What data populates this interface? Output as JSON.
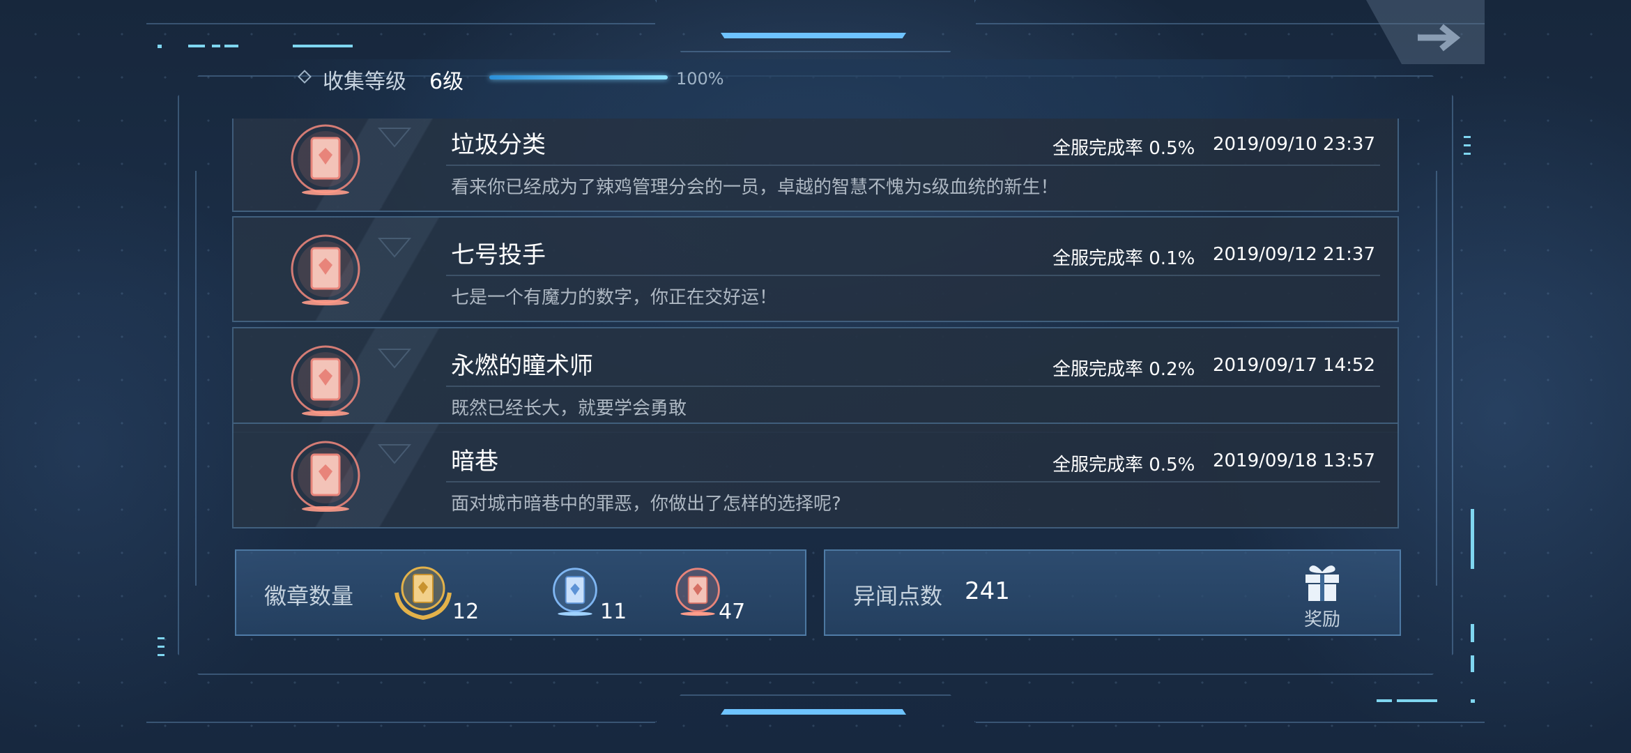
{
  "header": {
    "level_label": "收集等级",
    "level_value": "6级",
    "progress_percent": 100,
    "progress_text": "100%"
  },
  "achievements": [
    {
      "title": "垃圾分类",
      "rate": "全服完成率 0.5%",
      "date": "2019/09/10 23:37",
      "description": "看来你已经成为了辣鸡管理分会的一员，卓越的智慧不愧为s级血统的新生！"
    },
    {
      "title": "七号投手",
      "rate": "全服完成率 0.1%",
      "date": "2019/09/12 21:37",
      "description": "七是一个有魔力的数字，你正在交好运！"
    },
    {
      "title": "永燃的瞳术师",
      "rate": "全服完成率 0.2%",
      "date": "2019/09/17 14:52",
      "description": "既然已经长大，就要学会勇敢"
    },
    {
      "title": "暗巷",
      "rate": "全服完成率 0.5%",
      "date": "2019/09/18 13:57",
      "description": "面对城市暗巷中的罪恶，你做出了怎样的选择呢?"
    }
  ],
  "badges_panel": {
    "label": "徽章数量",
    "gold_count": "12",
    "blue_count": "11",
    "red_count": "47"
  },
  "points_panel": {
    "label": "异闻点数",
    "value": "241",
    "reward_label": "奖励"
  },
  "colors": {
    "accent": "#6ec3ff",
    "badge_red": "#e8847a",
    "badge_gold": "#e3b24a",
    "badge_blue": "#7fb6f2"
  },
  "icons": {
    "back": "arrow-right-icon",
    "reward": "gift-icon",
    "badge": "scroll-badge-icon"
  }
}
